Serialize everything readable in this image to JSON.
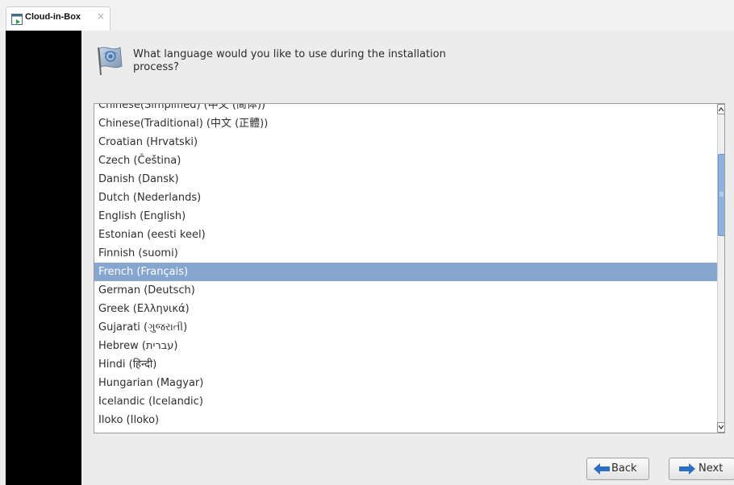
{
  "tab": {
    "title": "Cloud-in-Box",
    "close": "×"
  },
  "installer": {
    "question": "What language would you like to use during the installation process?",
    "languages": [
      "Chinese(Simplified) (中文 (简体))",
      "Chinese(Traditional) (中文 (正體))",
      "Croatian (Hrvatski)",
      "Czech (Čeština)",
      "Danish (Dansk)",
      "Dutch (Nederlands)",
      "English (English)",
      "Estonian (eesti keel)",
      "Finnish (suomi)",
      "French (Français)",
      "German (Deutsch)",
      "Greek (Ελληνικά)",
      "Gujarati (ગુજરાતી)",
      "Hebrew (עברית)",
      "Hindi (हिन्दी)",
      "Hungarian (Magyar)",
      "Icelandic (Icelandic)",
      "Iloko (Iloko)"
    ],
    "selected_index": 9,
    "buttons": {
      "back": "Back",
      "next": "Next"
    }
  },
  "colors": {
    "selection": "#86a5cf",
    "sidebar": "#000000",
    "background": "#ececec",
    "arrow_icon": "#2f6fc2"
  },
  "icons": {
    "tab": "window-icon",
    "header": "globe-flag-icon",
    "back": "arrow-left-icon",
    "next": "arrow-right-icon"
  }
}
